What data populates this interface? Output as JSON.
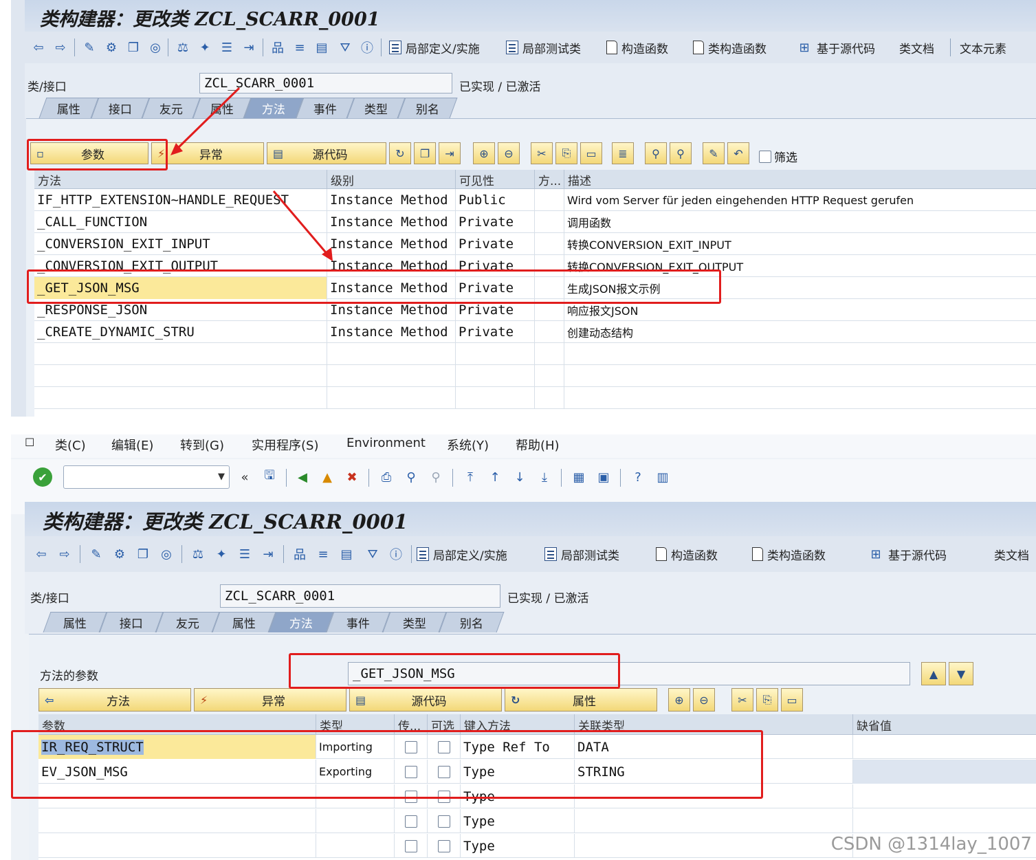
{
  "panel1": {
    "title": "类构建器：更改类 ZCL_SCARR_0001",
    "toolbar_buttons": [
      "局部定义/实施",
      "局部测试类",
      "构造函数",
      "类构造函数",
      "基于源代码",
      "类文档",
      "文本元素"
    ],
    "class_label": "类/接口",
    "class_value": "ZCL_SCARR_0001",
    "status": "已实现 / 已激活",
    "tabs": [
      "属性",
      "接口",
      "友元",
      "属性",
      "方法",
      "事件",
      "类型",
      "别名"
    ],
    "active_tab": "方法",
    "sub_buttons": {
      "params": "参数",
      "exceptions": "异常",
      "source": "源代码"
    },
    "filter_label": "筛选",
    "columns": [
      "方法",
      "级别",
      "可见性",
      "方...",
      "描述"
    ],
    "rows": [
      {
        "method": "IF_HTTP_EXTENSION~HANDLE_REQUEST",
        "level": "Instance Method",
        "visibility": "Public",
        "desc": "Wird vom Server für jeden eingehenden HTTP Request gerufen"
      },
      {
        "method": "_CALL_FUNCTION",
        "level": "Instance Method",
        "visibility": "Private",
        "desc": "调用函数"
      },
      {
        "method": "_CONVERSION_EXIT_INPUT",
        "level": "Instance Method",
        "visibility": "Private",
        "desc": "转换CONVERSION_EXIT_INPUT"
      },
      {
        "method": "_CONVERSION_EXIT_OUTPUT",
        "level": "Instance Method",
        "visibility": "Private",
        "desc": "转换CONVERSION_EXIT_OUTPUT"
      },
      {
        "method": "_GET_JSON_MSG",
        "level": "Instance Method",
        "visibility": "Private",
        "desc": "生成JSON报文示例"
      },
      {
        "method": "_RESPONSE_JSON",
        "level": "Instance Method",
        "visibility": "Private",
        "desc": "响应报文JSON"
      },
      {
        "method": "_CREATE_DYNAMIC_STRU",
        "level": "Instance Method",
        "visibility": "Private",
        "desc": "创建动态结构"
      }
    ]
  },
  "panel2": {
    "menu": [
      "类(C)",
      "编辑(E)",
      "转到(G)",
      "实用程序(S)",
      "Environment",
      "系统(Y)",
      "帮助(H)"
    ],
    "title": "类构建器：更改类 ZCL_SCARR_0001",
    "toolbar_buttons": [
      "局部定义/实施",
      "局部测试类",
      "构造函数",
      "类构造函数",
      "基于源代码",
      "类文档"
    ],
    "class_label": "类/接口",
    "class_value": "ZCL_SCARR_0001",
    "status": "已实现 / 已激活",
    "tabs": [
      "属性",
      "接口",
      "友元",
      "属性",
      "方法",
      "事件",
      "类型",
      "别名"
    ],
    "active_tab": "方法",
    "method_params_label": "方法的参数",
    "method_name": "_GET_JSON_MSG",
    "sub_buttons": {
      "method": "方法",
      "exceptions": "异常",
      "source": "源代码",
      "attributes": "属性"
    },
    "columns": [
      "参数",
      "类型",
      "传...",
      "可选",
      "键入方法",
      "关联类型",
      "缺省值"
    ],
    "rows": [
      {
        "param": "IR_REQ_STRUCT",
        "type": "Importing",
        "typing": "Type Ref To",
        "ref": "DATA"
      },
      {
        "param": "EV_JSON_MSG",
        "type": "Exporting",
        "typing": "Type",
        "ref": "STRING"
      },
      {
        "param": "",
        "type": "",
        "typing": "Type",
        "ref": ""
      },
      {
        "param": "",
        "type": "",
        "typing": "Type",
        "ref": ""
      },
      {
        "param": "",
        "type": "",
        "typing": "Type",
        "ref": ""
      }
    ]
  },
  "watermark": "CSDN @1314lay_1007",
  "colors": {
    "highlight": "#fbe99a",
    "red_annotation": "#e11d1d",
    "sap_panel": "#dfe6f0",
    "active_tab": "#8fa6c9"
  }
}
